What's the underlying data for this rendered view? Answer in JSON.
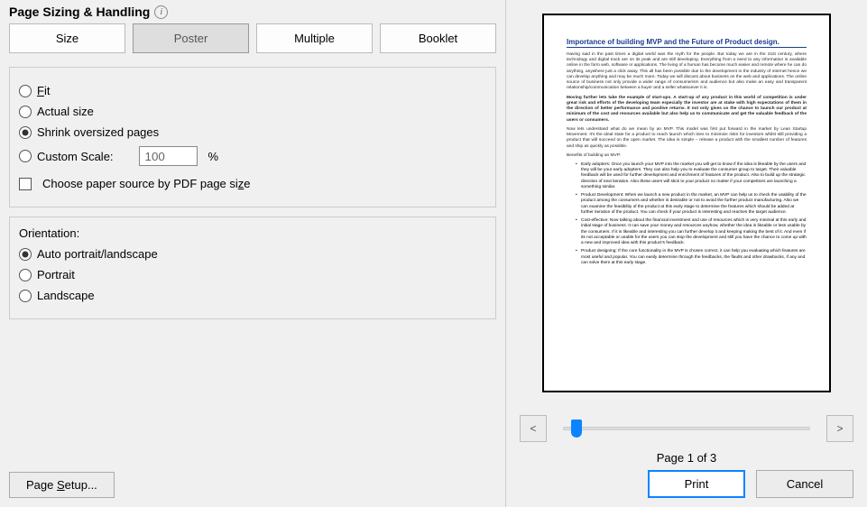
{
  "sectionHeader": "Page Sizing & Handling",
  "tabs": {
    "size": "Size",
    "poster": "Poster",
    "multiple": "Multiple",
    "booklet": "Booklet"
  },
  "sizing": {
    "fit": "Fit",
    "actual": "Actual size",
    "shrink": "Shrink oversized pages",
    "custom": "Custom Scale:",
    "customValue": "100",
    "percentSign": "%",
    "choosePaper": "Choose paper source by PDF page size"
  },
  "orientation": {
    "header": "Orientation:",
    "auto": "Auto portrait/landscape",
    "portrait": "Portrait",
    "landscape": "Landscape"
  },
  "pageSetup": "Page Setup...",
  "preview": {
    "title": "Importance of building MVP and the Future of Product design.",
    "p1": "Having said in the past times a digital world was the myth for the people. But today we are in the 21st century, where technology and digital track are on its peak and are still developing. Everything from a need to any information is available online in the form web, software or applications. The living of a human has become much easier and remote where he can do anything, anywhere just a click away. This all has been possible due to the development in the industry of internet hence we can develop anything and may be much more. Today we will discuss about business on the web and applications. The online source of business not only provide a wider range of consumerism and audience but also make an easy and transparent relationship/communication between a buyer and a seller whatsoever it is.",
    "p2": "Moving further lets take the example of start-ups. A start-up of any product in this world of competition is under great risk and efforts of the developing team especially the investor are at stake with high expectations of them in the direction of better performance and positive returns. It not only gives us the chance to launch our product at minimum of the cost and resources available but also help us to communicate and get the valuable feedback of the users or consumers.",
    "p3": "Now lets understand what do we mean by an MVP. This model was first put forward in the market by Lean Startup Movement. It's the ideal state for a product to reach launch which tries to minimize risks for investors whilst still providing a product that will succeed on the open market. The idea is simple – release a product with the smallest number of features and ship as quickly as possible.",
    "p4": "Benefits of building an MVP:",
    "b1": "Early adopters: Once you launch your MVP into the market you will get to know if the idea is likeable by the users and they will be your early adopters. They can also help you to evaluate the consumer group to target. Their valuable feedback will be used for further development and enrichment of features of the product. Also to build up the strategic direction of next iteration. Also these users will stick to your product no matter if your competitors are launching a something similar.",
    "b2": "Product Development: When we launch a new product in the market, an MVP can help us to check the usability of the product among the consumers and whether is desirable or not to avoid the further product manufacturing. Also we can examine the feasibility of the product at this early stage to determine the features which should be added at further iteration of the product. You can check if your product is interesting and reaches the target audience.",
    "b3": "Cost-effective: Now talking about the financial investment and use of resources which is very minimal at this early and initial stage of business. It can save your money and resources anyhow, whether the idea is likeable or less usable by the consumers. If it is likeable and interesting you can further develop it and keeping making the best of it. And even if its not acceptable or usable for the users you can stop the development and still you have the chance to come up with a new and improved idea with this product's feedback.",
    "b4": "Product designing: If the core functionality in the MVP is chosen correct, it can help you evaluating which features are most useful and popular. You can easily determine through the feedbacks, the flaults and other drawbacks, if any and can solve them at this early stage."
  },
  "nav": {
    "prev": "<",
    "next": ">",
    "indicator": "Page 1 of 3"
  },
  "actions": {
    "print": "Print",
    "cancel": "Cancel"
  }
}
